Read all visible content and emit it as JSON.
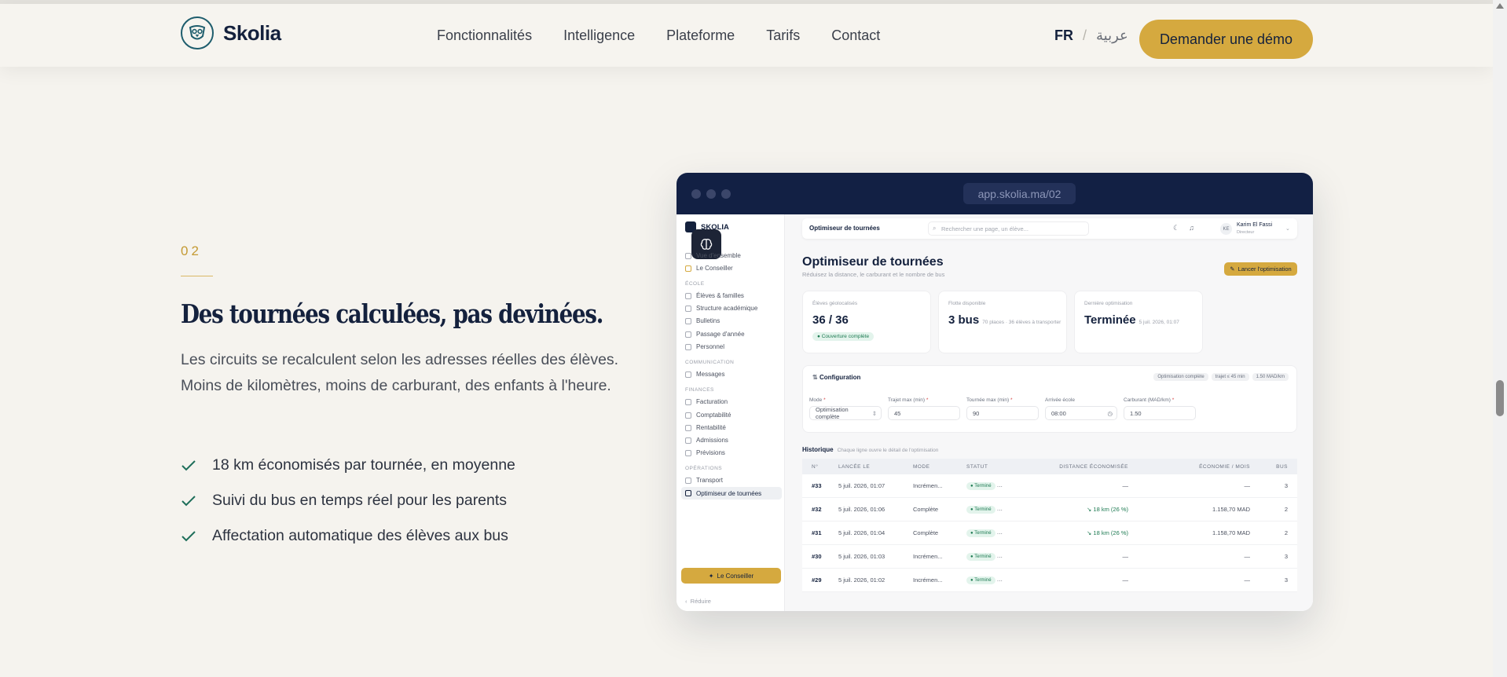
{
  "header": {
    "brand": "Skolia",
    "nav": [
      "Fonctionnalités",
      "Intelligence",
      "Plateforme",
      "Tarifs",
      "Contact"
    ],
    "lang_active": "FR",
    "lang_separator": "/",
    "lang_other": "عربية",
    "cta": "Demander une démo"
  },
  "feature": {
    "number": "02",
    "headline": "Des tournées calculées, pas devinées.",
    "lead": "Les circuits se recalculent selon les adresses réelles des élèves. Moins de kilomètres, moins de carburant, des enfants à l'heure.",
    "bullets": [
      "18 km économisés par tournée, en moyenne",
      "Suivi du bus en temps réel pour les parents",
      "Affectation automatique des élèves aux bus"
    ]
  },
  "browser": {
    "url": "app.skolia.ma/02"
  },
  "app": {
    "brand": "SKOLIA",
    "sidebar": {
      "items_top": [
        "Vue d'ensemble",
        "Le Conseiller"
      ],
      "section_ecole": "ÉCOLE",
      "items_ecole": [
        "Élèves & familles",
        "Structure académique",
        "Bulletins",
        "Passage d'année",
        "Personnel"
      ],
      "section_comm": "COMMUNICATION",
      "items_comm": [
        "Messages"
      ],
      "section_fin": "FINANCES",
      "items_fin": [
        "Facturation",
        "Comptabilité",
        "Rentabilité",
        "Admissions",
        "Prévisions"
      ],
      "section_ops": "OPÉRATIONS",
      "items_ops": [
        "Transport",
        "Optimiseur de tournées"
      ],
      "advisor_button": "Le Conseiller",
      "collapse": "Réduire"
    },
    "topbar": {
      "title": "Optimiseur de tournées",
      "search_placeholder": "Rechercher une page, un élève...",
      "avatar": "KE",
      "user": "Karim El Fassi",
      "role": "Directeur"
    },
    "page": {
      "title": "Optimiseur de tournées",
      "subtitle": "Réduisez la distance, le carburant et le nombre de bus",
      "launch": "Lancer l'optimisation"
    },
    "cards": [
      {
        "label": "Élèves géolocalisés",
        "value": "36 / 36",
        "extra": "",
        "badge": "Couverture complète"
      },
      {
        "label": "Flotte disponible",
        "value": "3 bus",
        "extra": "70 places · 36 élèves à transporter",
        "badge": ""
      },
      {
        "label": "Dernière optimisation",
        "value": "Terminée",
        "extra": "5 juil. 2026, 01:07",
        "badge": ""
      }
    ],
    "config": {
      "title": "Configuration",
      "tags": [
        "Optimisation complète",
        "trajet ≤ 45 min",
        "1.50 MAD/km"
      ],
      "fields": [
        {
          "label": "Mode",
          "value": "Optimisation complète"
        },
        {
          "label": "Trajet max (min)",
          "value": "45"
        },
        {
          "label": "Tournée max (min)",
          "value": "90"
        },
        {
          "label": "Arrivée école",
          "value": "08:00"
        },
        {
          "label": "Carburant (MAD/km)",
          "value": "1.50"
        }
      ]
    },
    "history": {
      "title": "Historique",
      "subtitle": "Chaque ligne ouvre le détail de l'optimisation",
      "columns": [
        "N°",
        "LANCÉE LE",
        "MODE",
        "STATUT",
        "DISTANCE ÉCONOMISÉE",
        "ÉCONOMIE / MOIS",
        "BUS"
      ],
      "rows": [
        {
          "n": "#33",
          "date": "5 juil. 2026, 01:07",
          "mode": "Incrémen...",
          "status": "Terminé",
          "dist": "—",
          "eco": "—",
          "bus": "3"
        },
        {
          "n": "#32",
          "date": "5 juil. 2026, 01:06",
          "mode": "Complète",
          "status": "Terminé",
          "dist": "↘ 18 km (26 %)",
          "eco": "1.158,70 MAD",
          "bus": "2"
        },
        {
          "n": "#31",
          "date": "5 juil. 2026, 01:04",
          "mode": "Complète",
          "status": "Terminé",
          "dist": "↘ 18 km (26 %)",
          "eco": "1.158,70 MAD",
          "bus": "2"
        },
        {
          "n": "#30",
          "date": "5 juil. 2026, 01:03",
          "mode": "Incrémen...",
          "status": "Terminé",
          "dist": "—",
          "eco": "—",
          "bus": "3"
        },
        {
          "n": "#29",
          "date": "5 juil. 2026, 01:02",
          "mode": "Incrémen...",
          "status": "Terminé",
          "dist": "—",
          "eco": "—",
          "bus": "3"
        }
      ]
    }
  },
  "colors": {
    "accent": "#d5a93f",
    "navy": "#14213d",
    "teal": "#1e5d6d",
    "success": "#1d7a52",
    "background": "#f5f3ee"
  }
}
